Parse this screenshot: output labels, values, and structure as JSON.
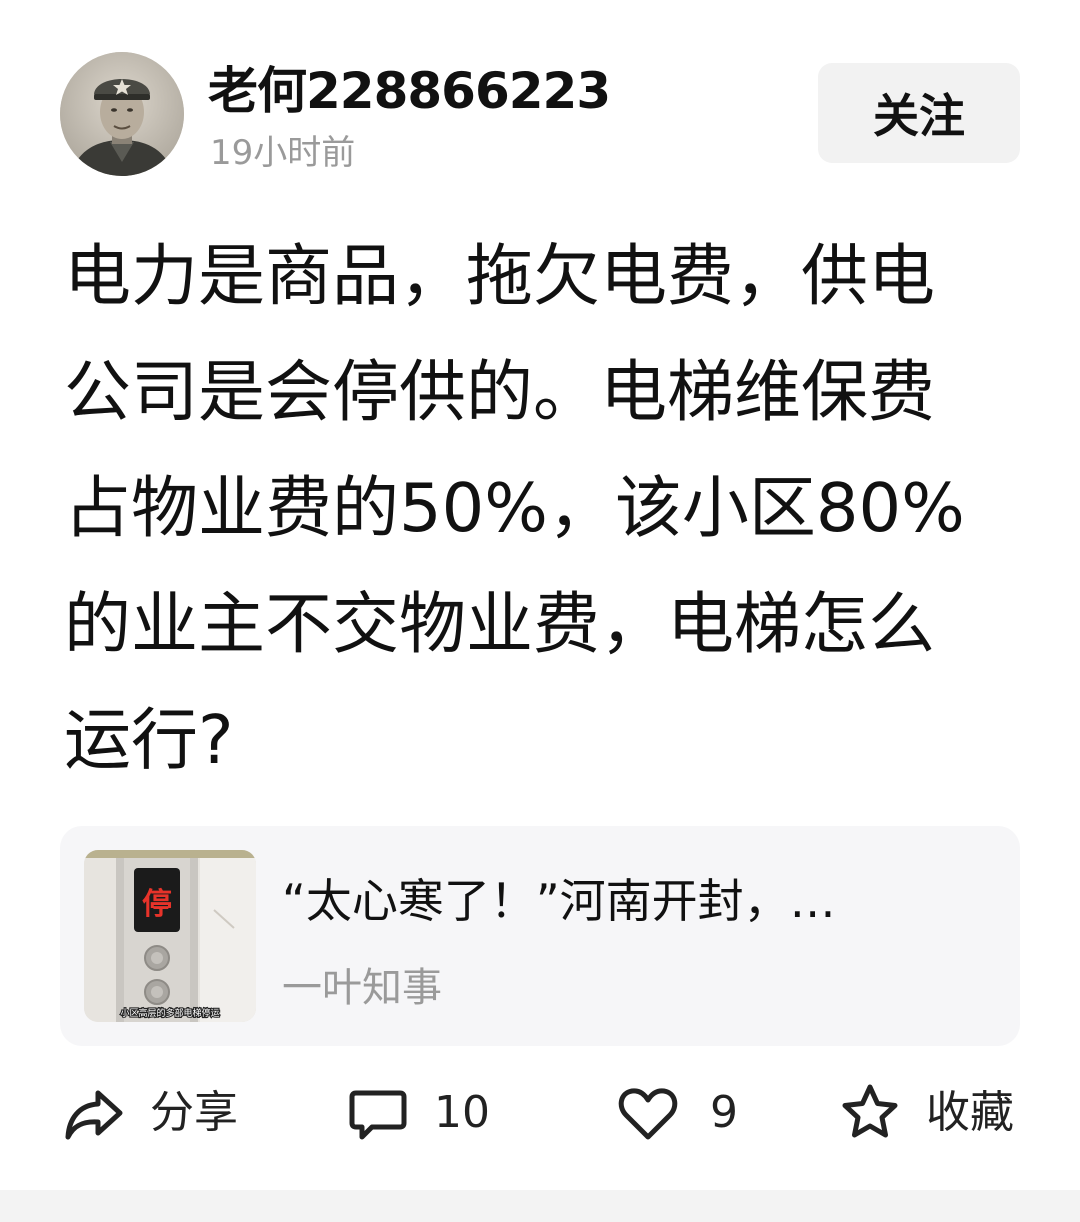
{
  "header": {
    "author_name": "老何228866223",
    "time": "19小时前",
    "follow_label": "关注"
  },
  "post": {
    "lines": [
      "电力是商品，拖欠电费，供电",
      "公司是会停供的。电梯维保费",
      "占物业费的50%，该小区80%",
      "的业主不交物业费，电梯怎么",
      "运行?"
    ]
  },
  "link_card": {
    "title": "“太心寒了！”河南开封，…",
    "source": "一叶知事",
    "thumbnail": {
      "icon": "elevator-panel-image",
      "display_char": "停",
      "caption": "小区高层的多部电梯停运"
    }
  },
  "actions": {
    "share": {
      "icon": "share-icon",
      "label": "分享"
    },
    "comment": {
      "icon": "comment-icon",
      "count": "10"
    },
    "like": {
      "icon": "heart-icon",
      "count": "9"
    },
    "favorite": {
      "icon": "star-icon",
      "label": "收藏"
    }
  },
  "colors": {
    "text": "#111111",
    "muted": "#9a9a9a",
    "card_bg": "#f6f6f8",
    "button_bg": "#f2f2f2",
    "led": "#e8332a"
  }
}
